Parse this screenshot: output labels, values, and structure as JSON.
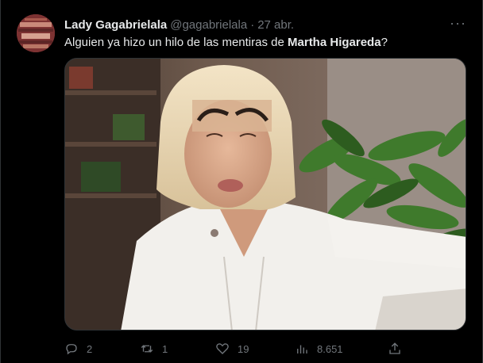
{
  "tweet": {
    "display_name": "Lady Gagabrielala",
    "handle": "@gagabrielala",
    "separator": "·",
    "date": "27 abr.",
    "more": "···",
    "text_before": "Alguien ya hizo un hilo de las mentiras de ",
    "text_bold": "Martha Higareda",
    "text_after": "?"
  },
  "actions": {
    "reply_count": "2",
    "retweet_count": "1",
    "like_count": "19",
    "views_count": "8.651"
  },
  "icons": {
    "reply": "reply-icon",
    "retweet": "retweet-icon",
    "like": "heart-icon",
    "views": "views-icon",
    "share": "share-icon"
  },
  "colors": {
    "background": "#000000",
    "text": "#e7e9ea",
    "muted": "#71767b",
    "border": "#2f3336"
  }
}
